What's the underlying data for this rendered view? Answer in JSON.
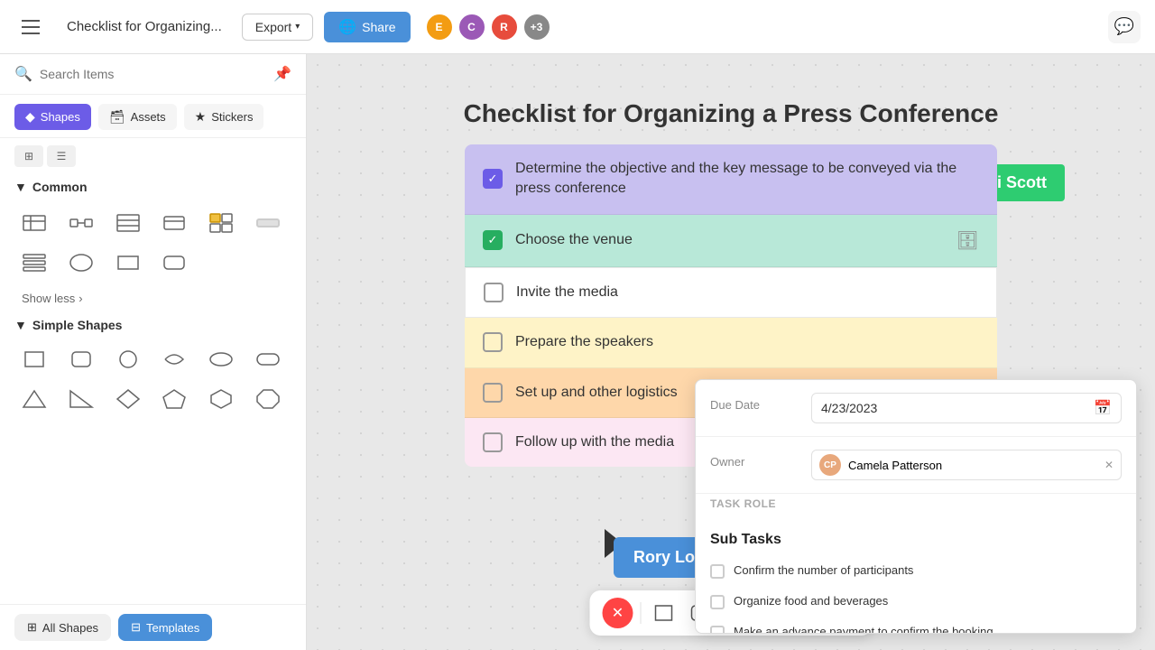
{
  "topbar": {
    "menu_label": "menu",
    "doc_title": "Checklist for Organizing...",
    "export_label": "Export",
    "share_label": "Share",
    "avatar_count": "+3",
    "avatars": [
      {
        "color": "#f39c12",
        "initials": "E"
      },
      {
        "color": "#9b59b6",
        "initials": "C"
      },
      {
        "color": "#e74c3c",
        "initials": "R"
      }
    ]
  },
  "sidebar": {
    "search_placeholder": "Search Items",
    "tabs": [
      {
        "label": "Shapes",
        "icon": "◆",
        "active": true
      },
      {
        "label": "Assets",
        "icon": "🗃"
      },
      {
        "label": "Stickers",
        "icon": "★"
      }
    ],
    "sections": {
      "common": {
        "label": "Common",
        "expanded": true
      },
      "simple_shapes": {
        "label": "Simple Shapes",
        "expanded": true
      }
    },
    "show_less": "Show less",
    "bottom_tabs": [
      {
        "label": "All Shapes",
        "icon": "⊞"
      },
      {
        "label": "Templates",
        "icon": "⊟"
      }
    ]
  },
  "canvas": {
    "title": "Checklist for Organizing a Press Conference",
    "items": [
      {
        "id": 1,
        "text": "Determine the objective and the key message to be conveyed via the press conference",
        "checked": true,
        "color": "blue",
        "check_type": "checked"
      },
      {
        "id": 2,
        "text": "Choose the venue",
        "checked": true,
        "color": "green",
        "check_type": "checked-green"
      },
      {
        "id": 3,
        "text": "Invite the media",
        "checked": false,
        "color": "white"
      },
      {
        "id": 4,
        "text": "Prepare the speakers",
        "checked": false,
        "color": "yellow"
      },
      {
        "id": 5,
        "text": "Set up and other logistics",
        "checked": false,
        "color": "orange"
      },
      {
        "id": 6,
        "text": "Follow up with the media",
        "checked": false,
        "color": "pink"
      }
    ]
  },
  "eli_label": "Eli Scott",
  "rory_label": "Rory Logan",
  "task_panel": {
    "due_date_label": "Due Date",
    "due_date_value": "4/23/2023",
    "owner_label": "Owner",
    "task_role_label": "TASK ROLE",
    "owner_name": "Camela Patterson",
    "subtasks_header": "Sub Tasks",
    "subtasks": [
      {
        "text": "Confirm the number of participants",
        "checked": false
      },
      {
        "text": "Organize food and beverages",
        "checked": false
      },
      {
        "text": "Make an advance payment to confirm the booking",
        "checked": false
      }
    ]
  },
  "bottom_toolbar": {
    "tools": [
      {
        "name": "close",
        "icon": "✕"
      },
      {
        "name": "rectangle",
        "icon": "□"
      },
      {
        "name": "rounded-rect",
        "icon": "▭"
      },
      {
        "name": "sticky",
        "icon": "◱"
      },
      {
        "name": "text",
        "icon": "T"
      },
      {
        "name": "line",
        "icon": "╱"
      },
      {
        "name": "pointer",
        "icon": "↗"
      }
    ]
  }
}
